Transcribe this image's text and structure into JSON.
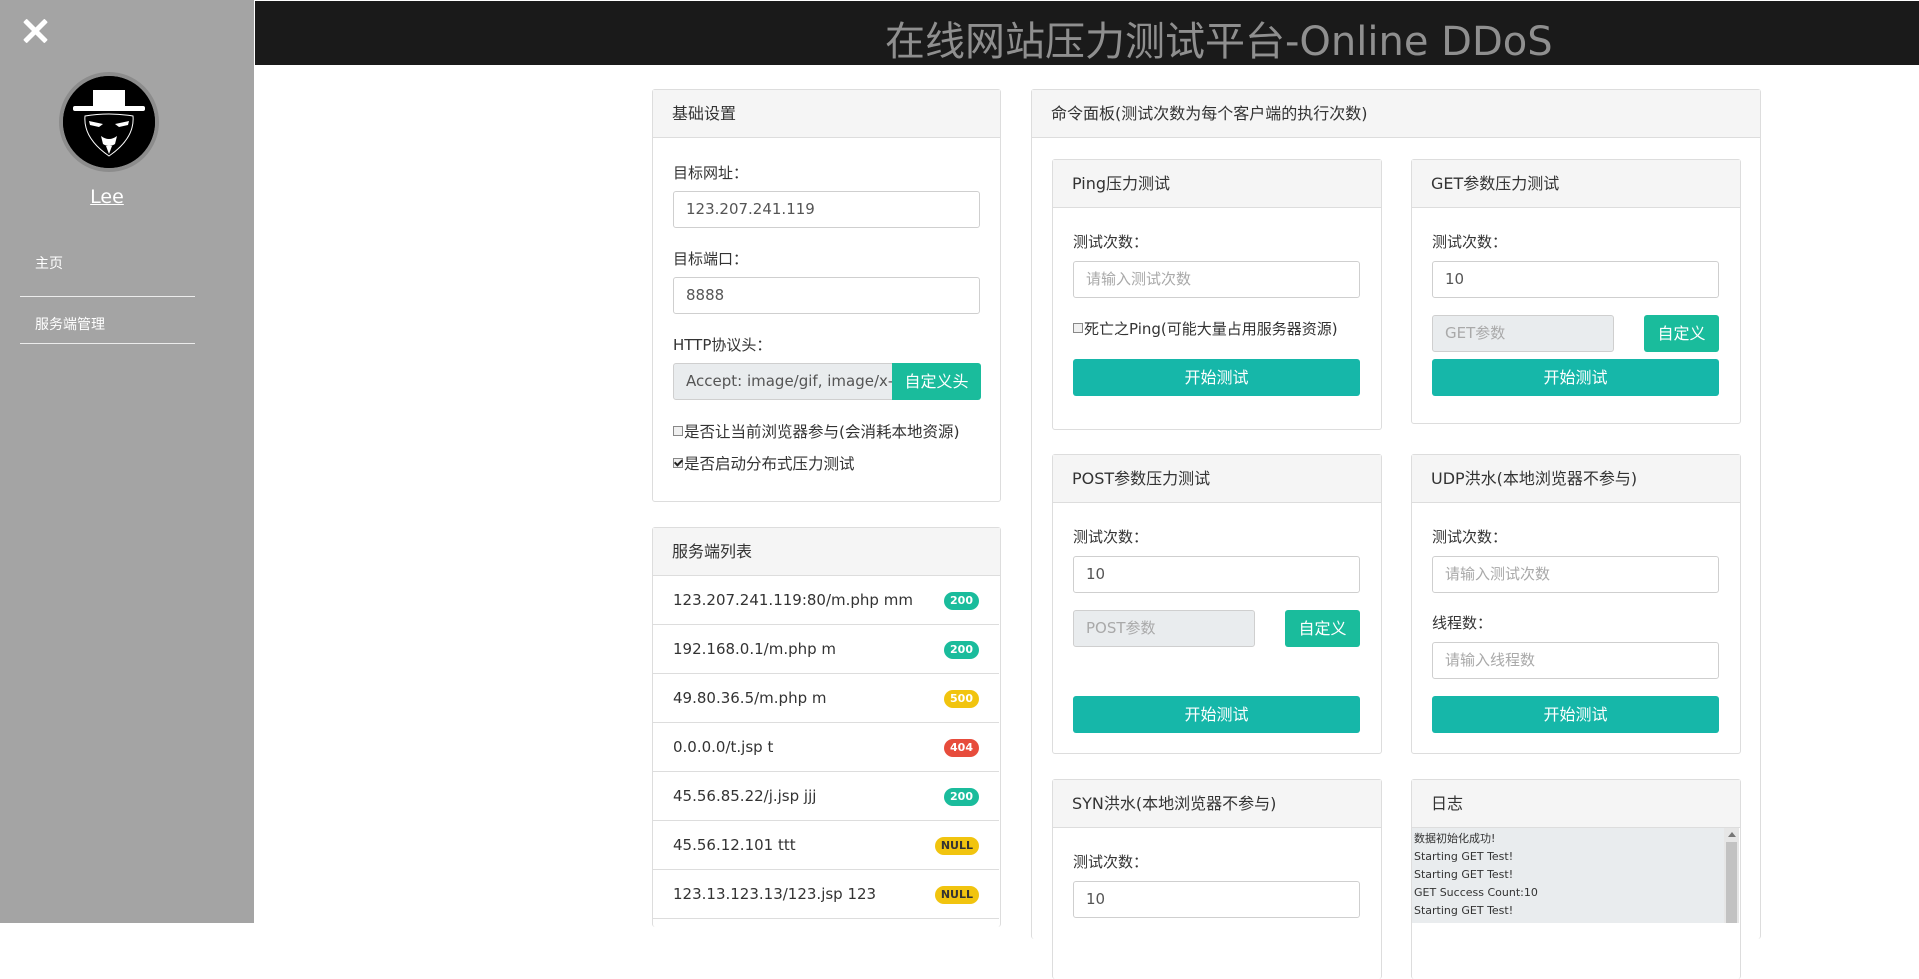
{
  "header": {
    "title": "在线网站压力测试平台-Online DDoS"
  },
  "sidebar": {
    "username": "Lee",
    "items": [
      {
        "label": "主页"
      },
      {
        "label": "服务端管理"
      }
    ]
  },
  "basic": {
    "heading": "基础设置",
    "target_url_label": "目标网址：",
    "target_url_value": "123.207.241.119",
    "target_port_label": "目标端口：",
    "target_port_value": "8888",
    "http_header_label": "HTTP协议头：",
    "http_header_value": "Accept: image/gif, image/x-xbitmap",
    "custom_header_button": "自定义头",
    "browser_participate": {
      "label": "是否让当前浏览器参与(会消耗本地资源)",
      "checked": false
    },
    "distributed": {
      "label": "是否启动分布式压力测试",
      "checked": true
    }
  },
  "server_list": {
    "heading": "服务端列表",
    "rows": [
      {
        "text": "123.207.241.119:80/m.php  mm",
        "badge": "200",
        "badge_color": "#1abc9c"
      },
      {
        "text": "192.168.0.1/m.php  m",
        "badge": "200",
        "badge_color": "#1abc9c"
      },
      {
        "text": "49.80.36.5/m.php  m",
        "badge": "500",
        "badge_color": "#f1c40f"
      },
      {
        "text": "0.0.0.0/t.jsp  t",
        "badge": "404",
        "badge_color": "#e74c3c"
      },
      {
        "text": "45.56.85.22/j.jsp  jjj",
        "badge": "200",
        "badge_color": "#1abc9c"
      },
      {
        "text": "45.56.12.101  ttt",
        "badge": "NULL",
        "badge_color": "#f1c40f"
      },
      {
        "text": "123.13.123.13/123.jsp  123",
        "badge": "NULL",
        "badge_color": "#f1c40f"
      }
    ]
  },
  "command": {
    "heading": "命令面板(测试次数为每个客户端的执行次数)",
    "ping": {
      "heading": "Ping压力测试",
      "count_label": "测试次数：",
      "count_placeholder": "请输入测试次数",
      "death_ping": {
        "label": "死亡之Ping(可能大量占用服务器资源)",
        "checked": false
      },
      "start_button": "开始测试"
    },
    "get": {
      "heading": "GET参数压力测试",
      "count_label": "测试次数：",
      "count_value": "10",
      "param_placeholder": "GET参数",
      "custom_button": "自定义",
      "start_button": "开始测试"
    },
    "post": {
      "heading": "POST参数压力测试",
      "count_label": "测试次数：",
      "count_value": "10",
      "param_placeholder": "POST参数",
      "custom_button": "自定义",
      "start_button": "开始测试"
    },
    "udp": {
      "heading": "UDP洪水(本地浏览器不参与)",
      "count_label": "测试次数：",
      "count_placeholder": "请输入测试次数",
      "threads_label": "线程数：",
      "threads_placeholder": "请输入线程数",
      "start_button": "开始测试"
    },
    "syn": {
      "heading": "SYN洪水(本地浏览器不参与)",
      "count_label": "测试次数：",
      "count_value": "10"
    },
    "log": {
      "heading": "日志",
      "lines": [
        "数据初始化成功!",
        "Starting GET Test!",
        "Starting GET Test!",
        "GET Success Count:10",
        "Starting GET Test!"
      ]
    }
  },
  "colors": {
    "accent": "#1abc9c",
    "sidebar_bg": "#a4a4a4",
    "header_bg": "#1a1a1a"
  }
}
